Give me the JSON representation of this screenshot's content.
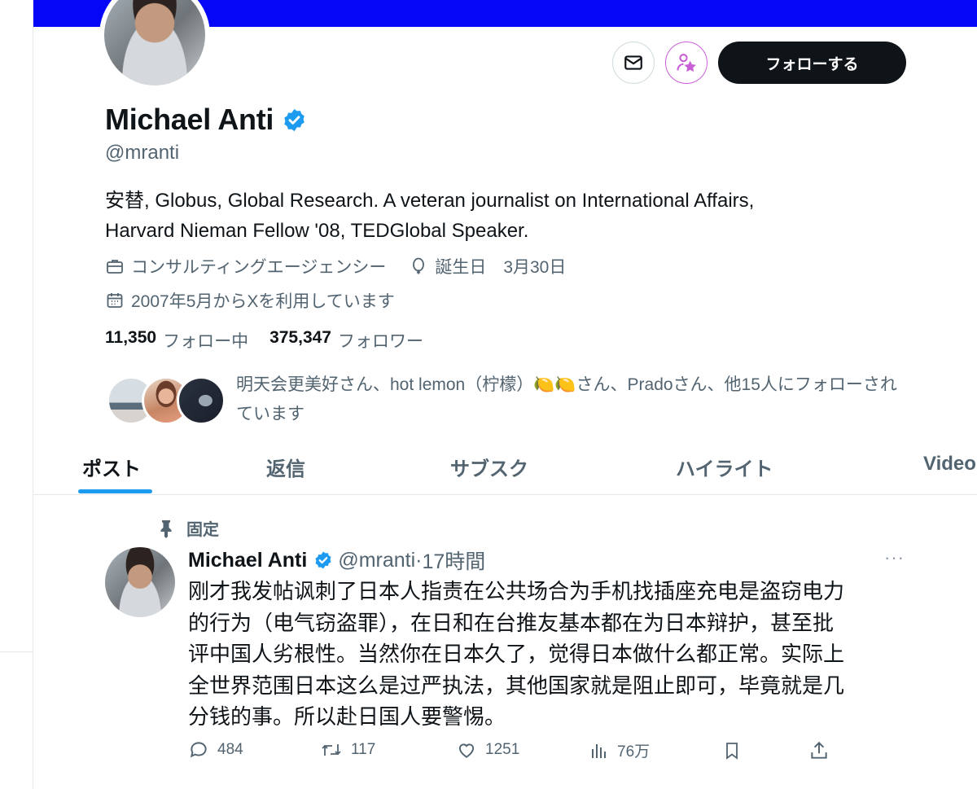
{
  "profile": {
    "name": "Michael Anti",
    "handle": "@mranti",
    "follow_label": "フォローする",
    "bio_lines": [
      "安替, Globus, Global Research. A veteran journalist on International Affairs,",
      "Harvard Nieman Fellow '08, TEDGlobal Speaker."
    ],
    "category": "コンサルティングエージェンシー",
    "birthday": "誕生日　3月30日",
    "joined": "2007年5月からXを利用しています",
    "following_count": "11,350",
    "following_label": "フォロー中",
    "followers_count": "375,347",
    "followers_label": "フォロワー",
    "followed_by": "明天会更美好さん、hot lemon（柠檬）🍋🍋さん、Pradoさん、他15人にフォローされています"
  },
  "tabs": [
    "ポスト",
    "返信",
    "サブスク",
    "ハイライト",
    "Video"
  ],
  "post": {
    "pinned_label": "固定",
    "author": "Michael Anti",
    "handle": "@mranti",
    "dot": "·",
    "time": "17時間",
    "more": "···",
    "body_lines": [
      "刚才我发帖讽刺了日本人指责在公共场合为手机找插座充电是盗窃电力",
      "的行为（电气窃盗罪），在日和在台推友基本都在为日本辩护，甚至批",
      "评中国人劣根性。当然你在日本久了，觉得日本做什么都正常。实际上",
      "全世界范围日本这么是过严执法，其他国家就是阻止即可，毕竟就是几",
      "分钱的事。所以赴日国人要警惕。"
    ],
    "replies": "484",
    "reposts": "117",
    "likes": "1251",
    "views": "76万"
  },
  "colors": {
    "banner": "#0505f7",
    "accent": "#1d9bf0",
    "subscribe": "#c95ed6"
  },
  "icons": [
    "envelope-icon",
    "subscribe-star-person-icon",
    "verified-badge-icon",
    "briefcase-icon",
    "balloon-icon",
    "calendar-icon",
    "pin-icon",
    "reply-icon",
    "repost-icon",
    "like-icon",
    "views-icon",
    "bookmark-icon",
    "share-icon"
  ]
}
